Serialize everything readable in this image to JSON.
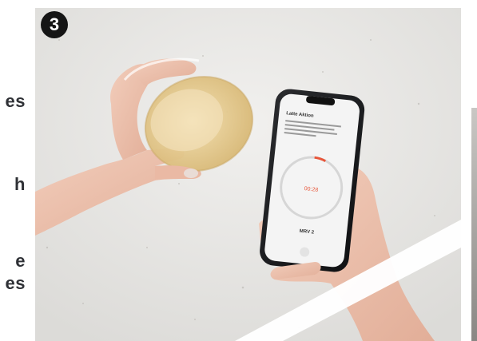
{
  "step_badge": "3",
  "left_text_fragments": [
    "es",
    "h",
    "e",
    "es"
  ],
  "phone_screen": {
    "heading": "Latte Aktion",
    "timer": "00:28",
    "bottom_label": "MRV 2"
  },
  "colors": {
    "badge": "#151515",
    "accent": "#e8563a",
    "background": "#e9e9e7"
  }
}
